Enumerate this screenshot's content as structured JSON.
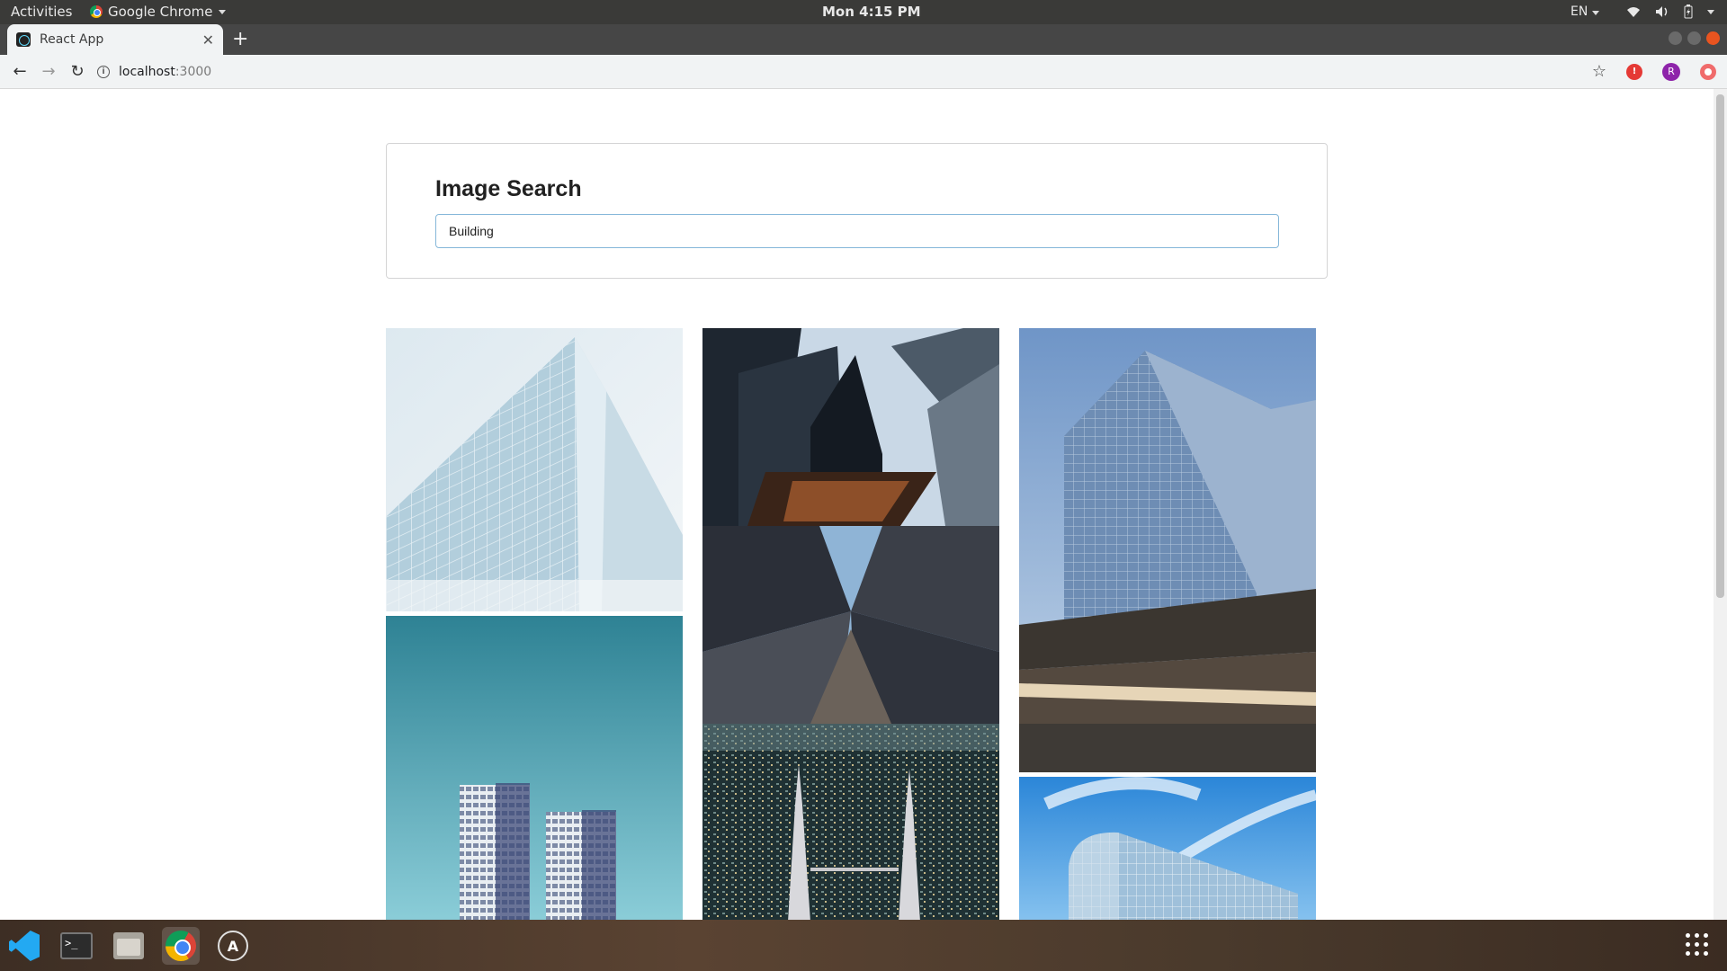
{
  "system_bar": {
    "activities": "Activities",
    "app_name": "Google Chrome",
    "clock": "Mon  4:15 PM",
    "language": "EN"
  },
  "browser": {
    "tab_title": "React App",
    "url_host": "localhost",
    "url_port": ":3000",
    "profile_initial": "R"
  },
  "page": {
    "heading": "Image Search",
    "search": {
      "value": "Building",
      "placeholder": ""
    }
  },
  "images": [
    {
      "name": "glass-facade-building",
      "column": 1
    },
    {
      "name": "twin-towers-teal-sky",
      "column": 1
    },
    {
      "name": "skyscrapers-looking-up",
      "column": 2
    },
    {
      "name": "skyscrapers-x-view",
      "column": 2
    },
    {
      "name": "petronas-towers-aerial",
      "column": 2
    },
    {
      "name": "modern-glass-office-building",
      "column": 3
    },
    {
      "name": "curved-glass-building-blue-sky",
      "column": 3
    }
  ],
  "dock": [
    "vscode-icon",
    "terminal-icon",
    "files-icon",
    "chrome-icon",
    "software-updater-icon",
    "show-apps-icon"
  ]
}
